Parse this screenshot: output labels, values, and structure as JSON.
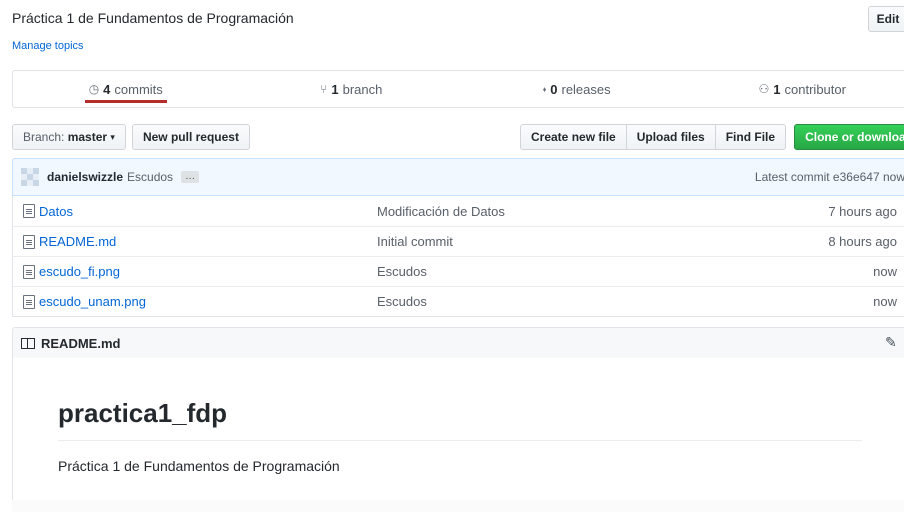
{
  "repo": {
    "description": "Práctica 1 de Fundamentos de Programación",
    "edit_label": "Edit",
    "manage_topics": "Manage topics"
  },
  "numbers": {
    "commits": {
      "count": "4",
      "label": "commits",
      "icon": "history-icon"
    },
    "branches": {
      "count": "1",
      "label": "branch",
      "icon": "branch-icon"
    },
    "releases": {
      "count": "0",
      "label": "releases",
      "icon": "tag-icon"
    },
    "contributors": {
      "count": "1",
      "label": "contributor",
      "icon": "people-icon"
    },
    "active_underline_color": "#b52d2d"
  },
  "toolbar": {
    "branch_prefix": "Branch:",
    "branch_name": "master",
    "new_pull_request": "New pull request",
    "create_new_file": "Create new file",
    "upload_files": "Upload files",
    "find_file": "Find File",
    "clone_or_download": "Clone or download",
    "green": "#28a745"
  },
  "latest_commit": {
    "author": "danielswizzle",
    "message": "Escudos",
    "ellipsis": "…",
    "summary": "Latest commit e36e647 now"
  },
  "files": [
    {
      "name": "Datos",
      "message": "Modificación de Datos",
      "age": "7 hours ago"
    },
    {
      "name": "README.md",
      "message": "Initial commit",
      "age": "8 hours ago"
    },
    {
      "name": "escudo_fi.png",
      "message": "Escudos",
      "age": "now"
    },
    {
      "name": "escudo_unam.png",
      "message": "Escudos",
      "age": "now"
    }
  ],
  "readme": {
    "header": "README.md",
    "heading": "practica1_fdp",
    "paragraph": "Práctica 1 de Fundamentos de Programación"
  }
}
